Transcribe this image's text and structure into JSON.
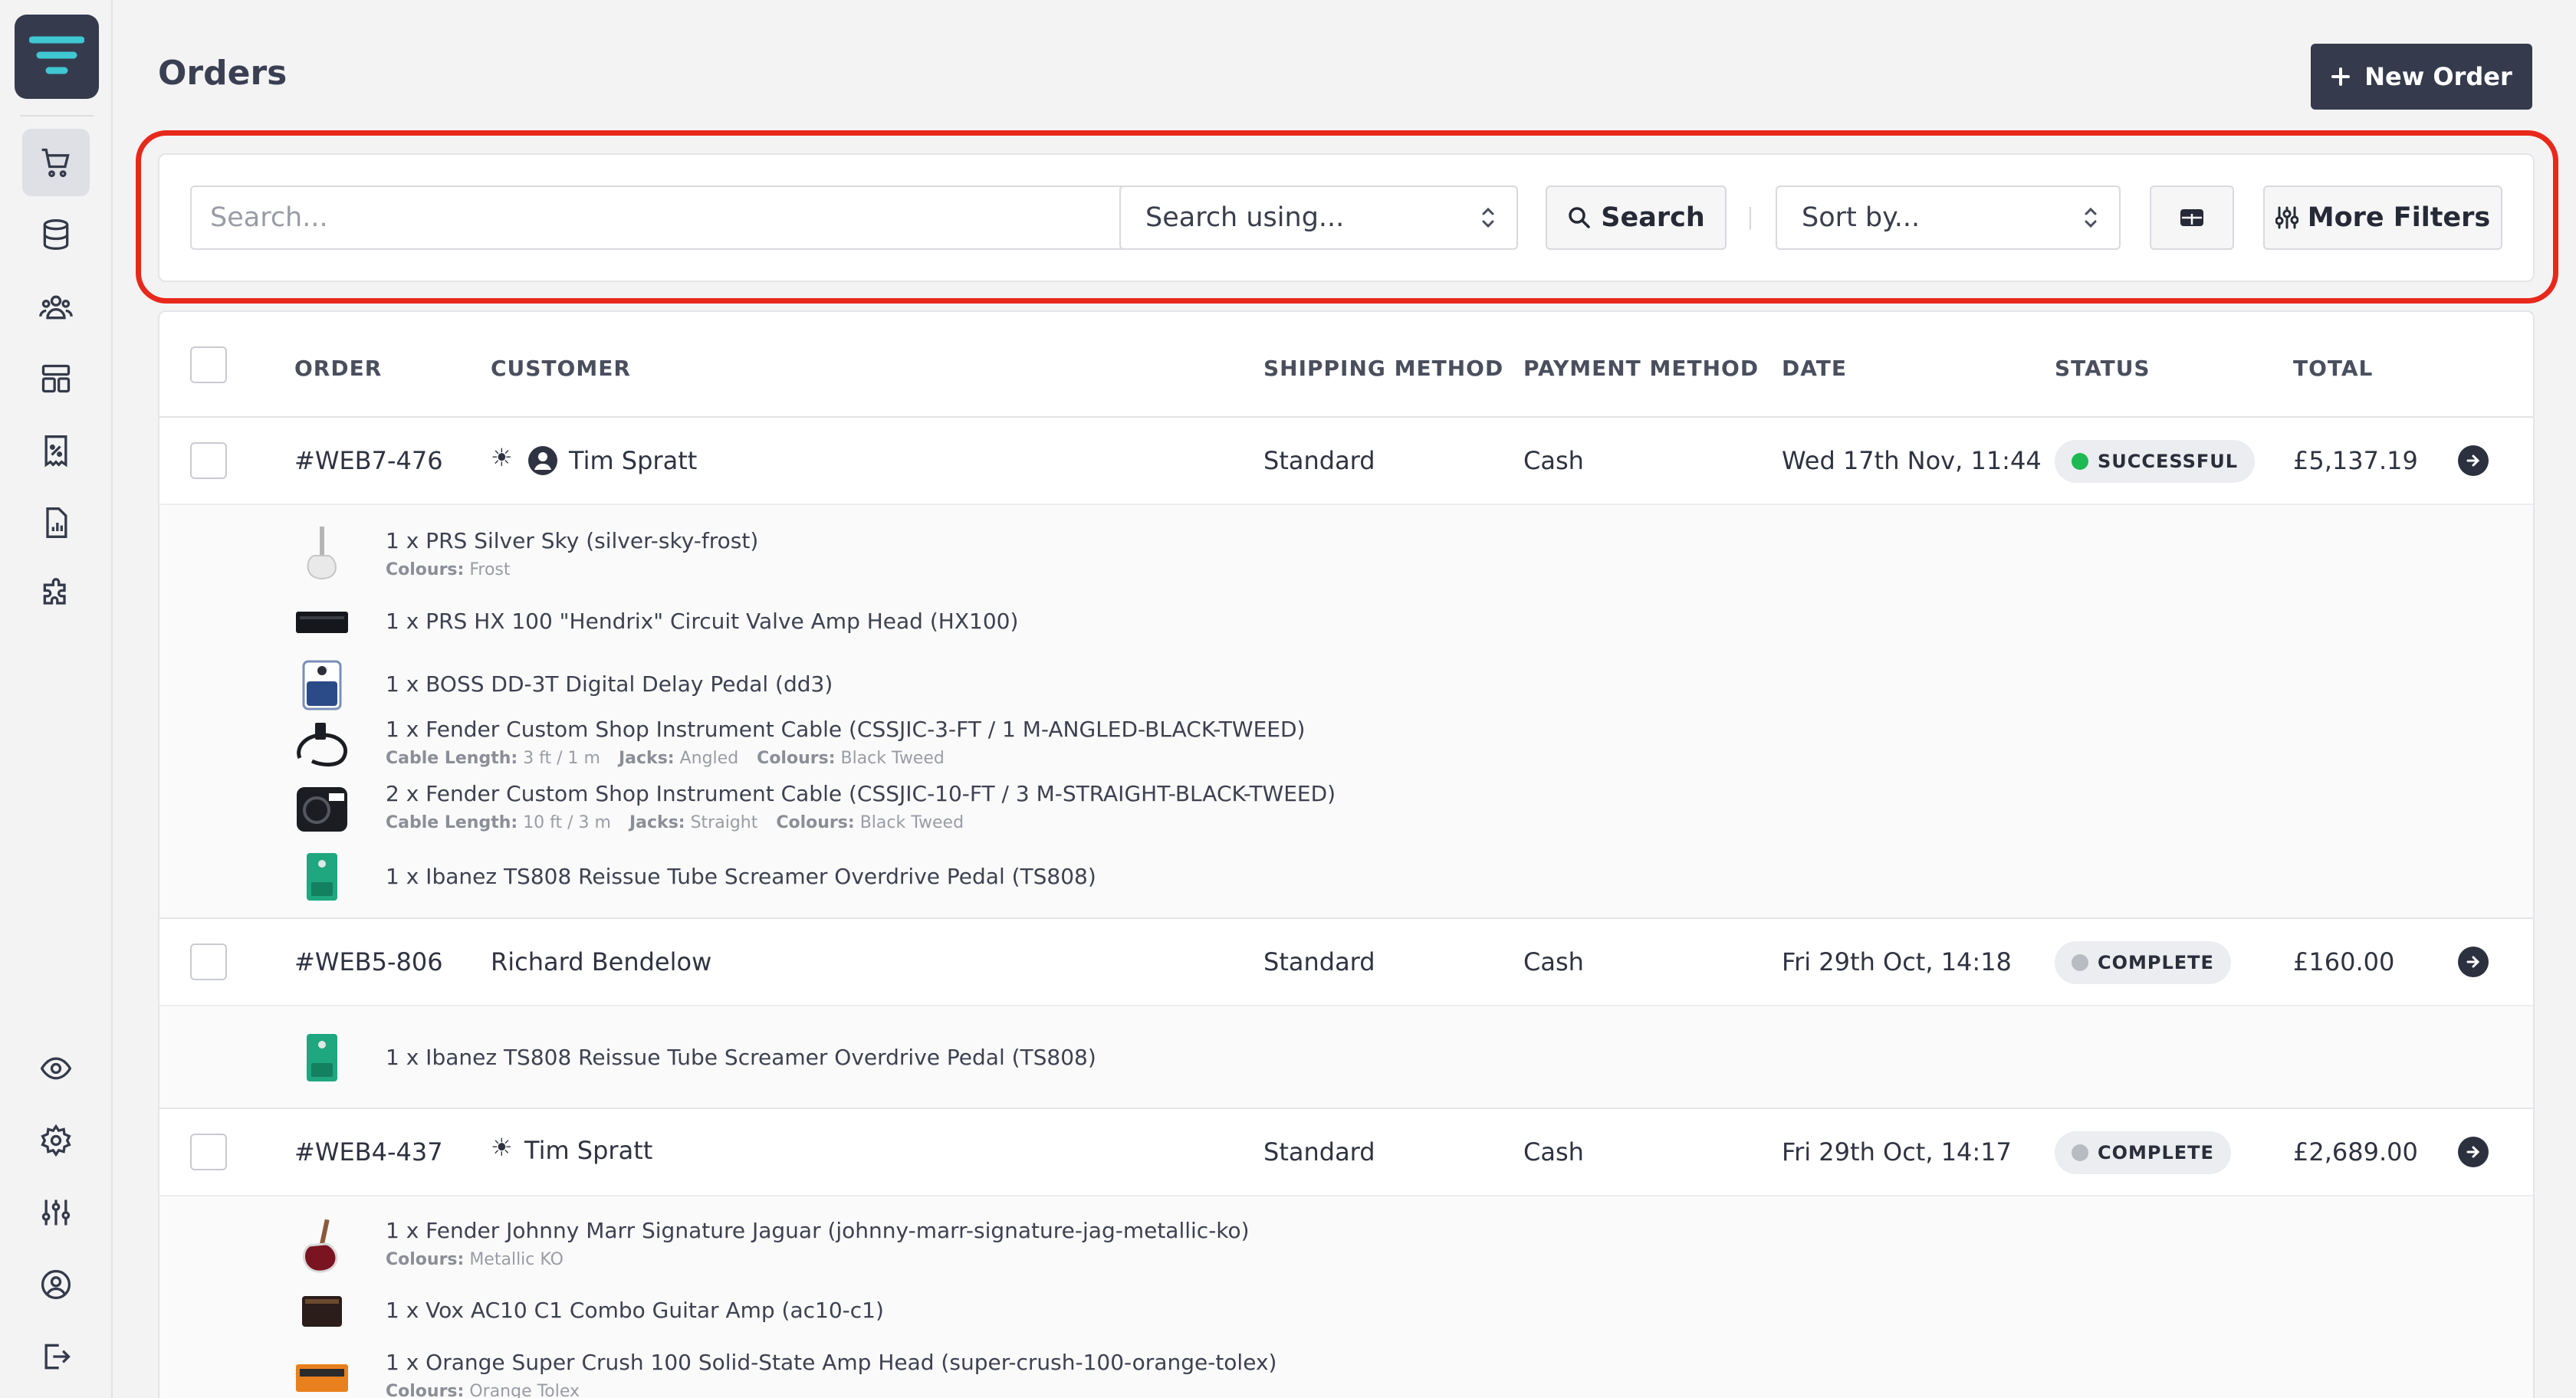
{
  "page": {
    "title": "Orders",
    "new_order_label": "New Order"
  },
  "filters": {
    "search_placeholder": "Search...",
    "search_using_label": "Search using...",
    "search_button_label": "Search",
    "sort_label": "Sort by...",
    "more_filters_label": "More Filters"
  },
  "table": {
    "headers": {
      "order": "ORDER",
      "customer": "CUSTOMER",
      "shipping": "SHIPPING METHOD",
      "payment": "PAYMENT METHOD",
      "date": "DATE",
      "status": "STATUS",
      "total": "TOTAL"
    },
    "orders": [
      {
        "id": "#WEB7-476",
        "customer": "Tim Spratt",
        "shipping": "Standard",
        "payment": "Cash",
        "date": "Wed 17th Nov, 11:44",
        "status": "SUCCESSFUL",
        "status_color": "#1db954",
        "total": "£5,137.19",
        "items": [
          {
            "name": "1 x PRS Silver Sky (silver-sky-frost)",
            "options": [
              {
                "k": "Colours:",
                "v": "Frost"
              }
            ]
          },
          {
            "name": "1 x PRS HX 100 \"Hendrix\" Circuit Valve Amp Head (HX100)",
            "options": []
          },
          {
            "name": "1 x BOSS DD-3T Digital Delay Pedal (dd3)",
            "options": []
          },
          {
            "name": "1 x Fender Custom Shop Instrument Cable (CSSJIC-3-FT / 1 M-ANGLED-BLACK-TWEED)",
            "options": [
              {
                "k": "Cable Length:",
                "v": "3 ft / 1 m"
              },
              {
                "k": "Jacks:",
                "v": "Angled"
              },
              {
                "k": "Colours:",
                "v": "Black Tweed"
              }
            ]
          },
          {
            "name": "2 x Fender Custom Shop Instrument Cable (CSSJIC-10-FT / 3 M-STRAIGHT-BLACK-TWEED)",
            "options": [
              {
                "k": "Cable Length:",
                "v": "10 ft / 3 m"
              },
              {
                "k": "Jacks:",
                "v": "Straight"
              },
              {
                "k": "Colours:",
                "v": "Black Tweed"
              }
            ]
          },
          {
            "name": "1 x Ibanez TS808 Reissue Tube Screamer Overdrive Pedal (TS808)",
            "options": []
          }
        ]
      },
      {
        "id": "#WEB5-806",
        "customer": "Richard Bendelow",
        "shipping": "Standard",
        "payment": "Cash",
        "date": "Fri 29th Oct, 14:18",
        "status": "COMPLETE",
        "status_color": "#b9bbc2",
        "total": "£160.00",
        "items": [
          {
            "name": "1 x Ibanez TS808 Reissue Tube Screamer Overdrive Pedal (TS808)",
            "options": []
          }
        ]
      },
      {
        "id": "#WEB4-437",
        "customer": "Tim Spratt",
        "shipping": "Standard",
        "payment": "Cash",
        "date": "Fri 29th Oct, 14:17",
        "status": "COMPLETE",
        "status_color": "#b9bbc2",
        "total": "£2,689.00",
        "items": [
          {
            "name": "1 x Fender Johnny Marr Signature Jaguar (johnny-marr-signature-jag-metallic-ko)",
            "options": [
              {
                "k": "Colours:",
                "v": "Metallic KO"
              }
            ]
          },
          {
            "name": "1 x Vox AC10 C1 Combo Guitar Amp (ac10-c1)",
            "options": []
          },
          {
            "name": "1 x Orange Super Crush 100 Solid-State Amp Head (super-crush-100-orange-tolex)",
            "options": [
              {
                "k": "Colours:",
                "v": "Orange Tolex"
              }
            ]
          }
        ]
      }
    ]
  },
  "icons": {
    "sidebar_top": [
      "cart-icon",
      "database-icon",
      "users-icon",
      "layout-icon",
      "receipt-percent-icon",
      "report-icon",
      "puzzle-icon"
    ],
    "sidebar_bottom": [
      "eye-icon",
      "gear-icon",
      "sliders-icon",
      "user-circle-icon",
      "logout-icon"
    ]
  },
  "colors": {
    "accent": "#353b4d",
    "logo_teal": "#3fc7d2",
    "highlight": "#e8281b",
    "success": "#1db954"
  }
}
